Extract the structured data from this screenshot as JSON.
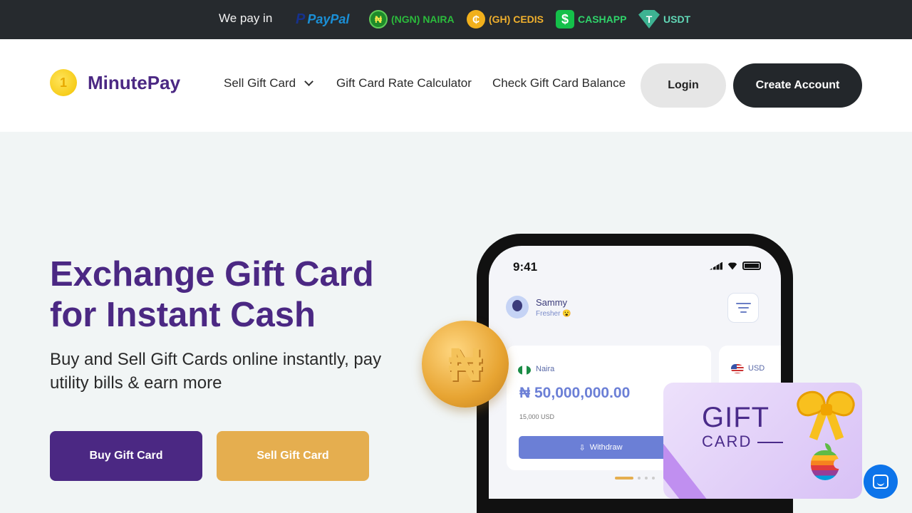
{
  "topbar": {
    "lead": "We pay in",
    "methods": [
      {
        "icon": "paypal-icon",
        "label": "PayPal",
        "color": "#1b8fd6"
      },
      {
        "icon": "naira-coin-icon",
        "label": "(NGN) NAIRA",
        "color": "#2bbb3c"
      },
      {
        "icon": "cedi-coin-icon",
        "label": "(GH) CEDIS",
        "color": "#f0b02d"
      },
      {
        "icon": "cashapp-icon",
        "label": "CASHAPP",
        "color": "#2fd36a"
      },
      {
        "icon": "tether-icon",
        "label": "USDT",
        "color": "#61d7b6"
      }
    ]
  },
  "header": {
    "logo_text": "MinutePay",
    "nav": {
      "sell": "Sell Gift Card",
      "calculator": "Gift Card Rate Calculator",
      "balance": "Check Gift Card Balance"
    },
    "login": "Login",
    "create": "Create Account"
  },
  "hero": {
    "title": "Exchange Gift Card for Instant Cash",
    "subtitle": "Buy and Sell Gift Cards online instantly, pay utility bills & earn more",
    "buy_button": "Buy Gift Card",
    "sell_button": "Sell Gift Card"
  },
  "phone": {
    "time": "9:41",
    "user_name": "Sammy",
    "user_role": "Fresher 😮",
    "naira_label": "Naira",
    "naira_amount": "₦ 50,000,000.00",
    "naira_usd": "15,000 USD",
    "withdraw": "Withdraw",
    "usd_label": "USD"
  },
  "gift_card": {
    "line1": "GIFT",
    "line2": "CARD"
  },
  "colors": {
    "brand_purple": "#4b2883",
    "accent_gold": "#e5ae4f",
    "dark": "#23272b"
  }
}
